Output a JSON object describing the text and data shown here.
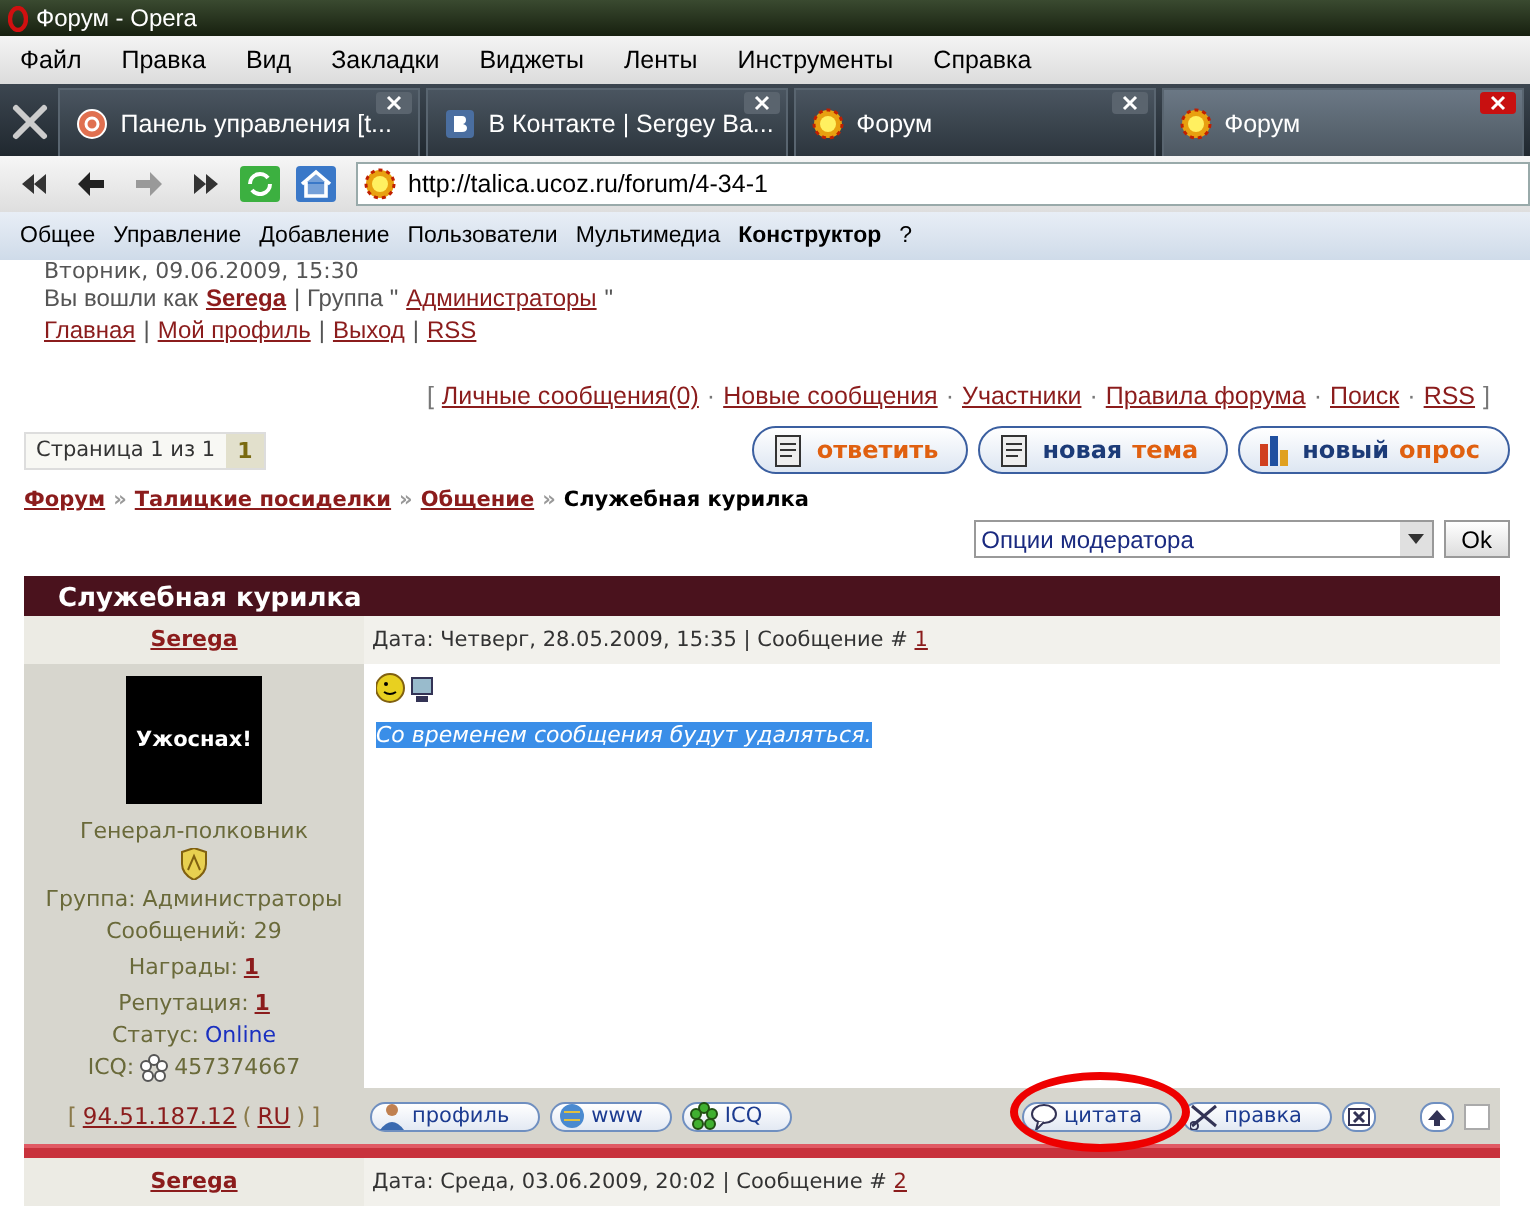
{
  "window": {
    "title": "Форум - Opera"
  },
  "menu": [
    "Файл",
    "Правка",
    "Вид",
    "Закладки",
    "Виджеты",
    "Ленты",
    "Инструменты",
    "Справка"
  ],
  "tabs": [
    {
      "label": "Панель управления [t...",
      "kind": "panel",
      "selected": false
    },
    {
      "label": "В Контакте | Sergey Ba...",
      "kind": "vk",
      "selected": false
    },
    {
      "label": "Форум",
      "kind": "forum",
      "selected": false
    },
    {
      "label": "Форум",
      "kind": "forum",
      "selected": true
    }
  ],
  "address": {
    "url": "http://talica.ucoz.ru/forum/4-34-1"
  },
  "panel": [
    {
      "label": "Общее",
      "selected": false
    },
    {
      "label": "Управление",
      "selected": false
    },
    {
      "label": "Добавление",
      "selected": false
    },
    {
      "label": "Пользователи",
      "selected": false
    },
    {
      "label": "Мультимедиа",
      "selected": false
    },
    {
      "label": "Конструктор",
      "selected": true
    },
    {
      "label": "?",
      "selected": false
    }
  ],
  "page": {
    "date_line": "Вторник, 09.06.2009, 15:30",
    "login": [
      {
        "kind": "text",
        "text": "Вы вошли как"
      },
      {
        "kind": "user",
        "text": "Serega"
      },
      {
        "kind": "text",
        "text": "| Группа \""
      },
      {
        "kind": "link",
        "text": "Администраторы"
      },
      {
        "kind": "text",
        "text": "\""
      }
    ],
    "nav": {
      "separator": "|",
      "links": [
        "Главная",
        "Мой профиль",
        "Выход",
        "RSS"
      ]
    },
    "forum_links": {
      "open": "[",
      "close": "]",
      "separator": "·",
      "links": [
        "Личные сообщения(0)",
        "Новые сообщения",
        "Участники",
        "Правила форума",
        "Поиск",
        "RSS"
      ]
    },
    "pager": {
      "label": "Страница 1 из 1",
      "pages": [
        {
          "label": "1",
          "selected": true
        }
      ]
    },
    "actions": [
      {
        "kind": "reply",
        "accent": "ответить"
      },
      {
        "kind": "topic",
        "main": "новая",
        "accent": "тема"
      },
      {
        "kind": "poll",
        "main": "новый",
        "accent": "опрос"
      }
    ],
    "breadcrumb": {
      "separator": "»",
      "links": [
        "Форум",
        "Талицкие посиделки",
        "Общение"
      ],
      "current": "Служебная курилка"
    },
    "moderator": {
      "value": "Опции модератора",
      "button": "Ok"
    },
    "thread_title": "Служебная курилка",
    "posts": [
      {
        "author": "Serega",
        "date": "Дата: Четверг, 28.05.2009, 15:35 | Сообщение #",
        "number": "1",
        "avatar_text": "Ужоснах!",
        "rank": "Генерал-полковник",
        "group": "Группа: Администраторы",
        "messages": "Сообщений: 29",
        "awards_label": "Награды:",
        "awards": "1",
        "reputation_label": "Репутация:",
        "reputation": "1",
        "status_label": "Статус:",
        "status": "Online",
        "icq_label": "ICQ:",
        "icq": "457374667",
        "message": "Со временем сообщения будут удаляться.",
        "highlighted": true,
        "ip_open": "[",
        "ip": "94.51.187.12",
        "country_open": "(",
        "country": "RU",
        "country_close": ")",
        "ip_close": "]",
        "buttons": [
          {
            "kind": "profile",
            "label": "профиль"
          },
          {
            "kind": "www",
            "label": "www"
          },
          {
            "kind": "icq",
            "label": "ICQ"
          }
        ],
        "tools": [
          {
            "kind": "quote",
            "label": "цитата",
            "circled": true
          },
          {
            "kind": "edit",
            "label": "правка",
            "circled": false
          }
        ],
        "selected": false
      },
      {
        "author": "Serega",
        "date": "Дата: Среда, 03.06.2009, 20:02 | Сообщение #",
        "number": "2"
      }
    ]
  }
}
